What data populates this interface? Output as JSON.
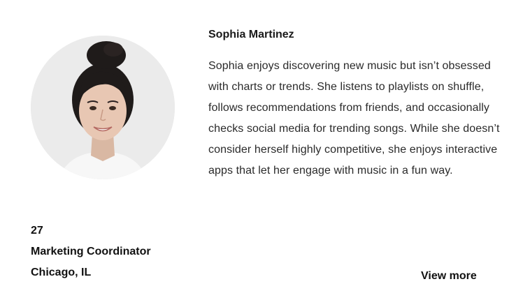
{
  "profile": {
    "name": "Sophia Martinez",
    "bio": "Sophia enjoys discovering new music but isn’t obsessed with charts or trends. She listens to playlists on shuffle, follows recommendations from friends, and occasionally checks social media for trending songs. While she doesn’t consider herself highly competitive, she enjoys interactive apps that let her engage with music in a fun way.",
    "age": "27",
    "occupation": "Marketing Coordinator",
    "location": "Chicago, IL",
    "avatar_icon": "avatar-photo-icon"
  },
  "actions": {
    "view_more_label": "View more"
  }
}
